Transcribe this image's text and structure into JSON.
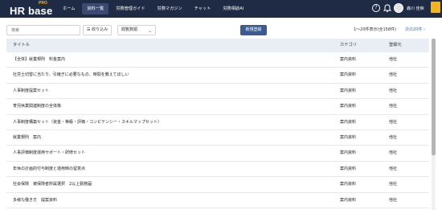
{
  "brand": {
    "logo_text": "HR base",
    "logo_badge": "PRO"
  },
  "nav": {
    "items": [
      {
        "label": "ホーム",
        "active": false
      },
      {
        "label": "資料一覧",
        "active": true
      },
      {
        "label": "労務管理ガイド",
        "active": false
      },
      {
        "label": "労務マガジン",
        "active": false
      },
      {
        "label": "チャット",
        "active": false
      },
      {
        "label": "労務相談AI",
        "active": false
      }
    ]
  },
  "user": {
    "name": "森川 佳映"
  },
  "icons": {
    "help": "help-circle-icon",
    "bell": "bell-icon",
    "filter": "filter-icon",
    "chevron": "chevron-down-icon",
    "next": "chevron-right-icon"
  },
  "colors": {
    "topbar": "#1f2a44",
    "primary_button": "#3b5b92",
    "link": "#2f6fd1",
    "badge": "#f0b429"
  },
  "toolbar": {
    "search_placeholder": "検索",
    "filter_label": "絞り込み",
    "sort_value": "閲覧数順",
    "new_button": "新規登録"
  },
  "pagination": {
    "range_text": "1～20件表示(全158件)",
    "next_label": "次の20件"
  },
  "table": {
    "headers": {
      "title": "タイトル",
      "category": "カテゴリ",
      "registrant": "登録元"
    },
    "rows": [
      {
        "title": "【全体】就業規則　料金案内",
        "category": "案内資料",
        "registrant": "他社"
      },
      {
        "title": "社労士切替に当たり、引継ぎに必要なもの、時間を教えてほしい",
        "category": "案内資料",
        "registrant": "他社"
      },
      {
        "title": "人事制度提案セット",
        "category": "案内資料",
        "registrant": "他社"
      },
      {
        "title": "育児休業関連制度の全体像",
        "category": "案内資料",
        "registrant": "他社"
      },
      {
        "title": "人事制度構築セット（資金・等級・評価・コンピテンシー・スキルマップセット）",
        "category": "案内資料",
        "registrant": "他社"
      },
      {
        "title": "就業規則　案内",
        "category": "案内資料",
        "registrant": "他社"
      },
      {
        "title": "人事評価制度運用サポート・研修セット",
        "category": "案内資料",
        "registrant": "他社"
      },
      {
        "title": "年休の計画的付与制度と運用時の留意点",
        "category": "案内資料",
        "registrant": "他社"
      },
      {
        "title": "社会保険　被保険者所属選択　2以上勤務届",
        "category": "案内資料",
        "registrant": "他社"
      },
      {
        "title": "多様な働き方　提案資料",
        "category": "案内資料",
        "registrant": "他社"
      }
    ]
  }
}
